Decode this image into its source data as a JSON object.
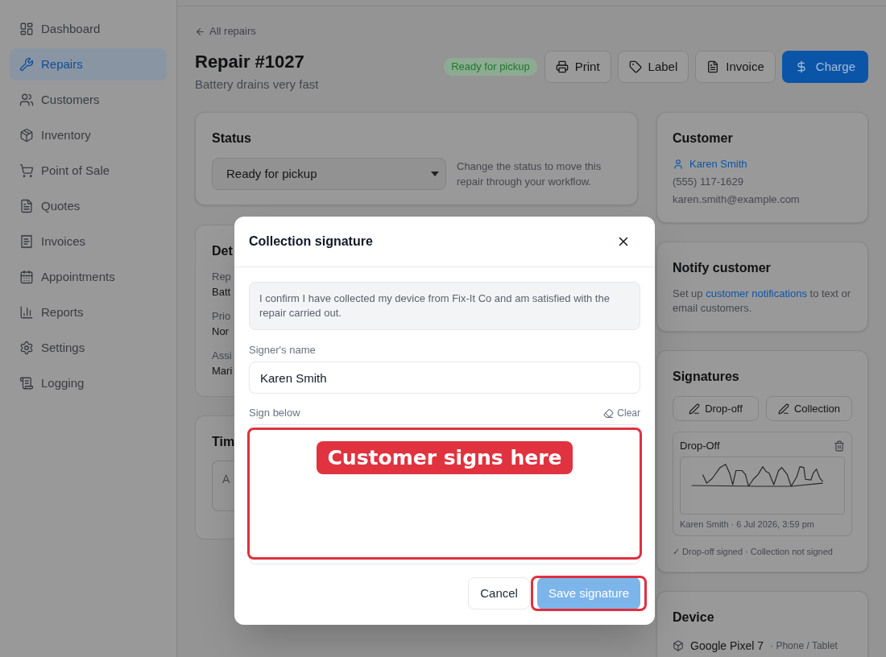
{
  "sidebar": {
    "items": [
      {
        "label": "Dashboard",
        "selected": false
      },
      {
        "label": "Repairs",
        "selected": true
      },
      {
        "label": "Customers",
        "selected": false
      },
      {
        "label": "Inventory",
        "selected": false
      },
      {
        "label": "Point of Sale",
        "selected": false
      },
      {
        "label": "Quotes",
        "selected": false
      },
      {
        "label": "Invoices",
        "selected": false
      },
      {
        "label": "Appointments",
        "selected": false
      },
      {
        "label": "Reports",
        "selected": false
      },
      {
        "label": "Settings",
        "selected": false
      },
      {
        "label": "Logging",
        "selected": false
      }
    ]
  },
  "header": {
    "back_link": "All repairs",
    "title": "Repair #1027",
    "subtitle": "Battery drains very fast",
    "status_badge": "Ready for pickup",
    "actions": [
      {
        "label": "Print",
        "kind": "secondary"
      },
      {
        "label": "Label",
        "kind": "secondary"
      },
      {
        "label": "Invoice",
        "kind": "secondary"
      },
      {
        "label": "Charge",
        "kind": "primary"
      }
    ]
  },
  "status_card": {
    "title": "Status",
    "select_value": "Ready for pickup",
    "help": "Change the status to move this repair through your workflow."
  },
  "details_card": {
    "title": "Det",
    "fields": [
      {
        "label": "Rep",
        "value": "Batt"
      },
      {
        "label": "Prio",
        "value": "Nor"
      },
      {
        "label": "Assi",
        "value": "Mari"
      }
    ]
  },
  "timeline_card": {
    "title": "Tim",
    "placeholder": "A"
  },
  "customer_card": {
    "title": "Customer",
    "name": "Karen Smith",
    "phone": "(555) 117-1629",
    "email": "karen.smith@example.com"
  },
  "notify_card": {
    "title": "Notify customer",
    "text_before": "Set up ",
    "link": "customer notifications",
    "text_after": " to text or email customers."
  },
  "signatures_card": {
    "title": "Signatures",
    "buttons": [
      "Drop-off",
      "Collection"
    ],
    "saved": [
      {
        "title": "Drop-Off",
        "caption": "Karen Smith · 6 Jul 2026, 3:59 pm"
      }
    ],
    "summary": "✓ Drop-off signed · Collection not signed"
  },
  "device_card": {
    "title": "Device",
    "name": "Google Pixel 7",
    "type": "· Phone / Tablet"
  },
  "dialog": {
    "title": "Collection signature",
    "statement": "I confirm I have collected my device from Fix-It Co and am satisfied with the repair carried out.",
    "name_label": "Signer's name",
    "name_value": "Karen Smith",
    "pad_label": "Sign below",
    "clear_label": "Clear",
    "pad_highlighted": true,
    "buttons": [
      {
        "label": "Cancel",
        "kind": "secondary",
        "disabled": false,
        "highlighted": false
      },
      {
        "label": "Save signature",
        "kind": "primary",
        "disabled": true,
        "highlighted": true
      }
    ]
  },
  "annotation": {
    "text": "Customer signs here"
  }
}
